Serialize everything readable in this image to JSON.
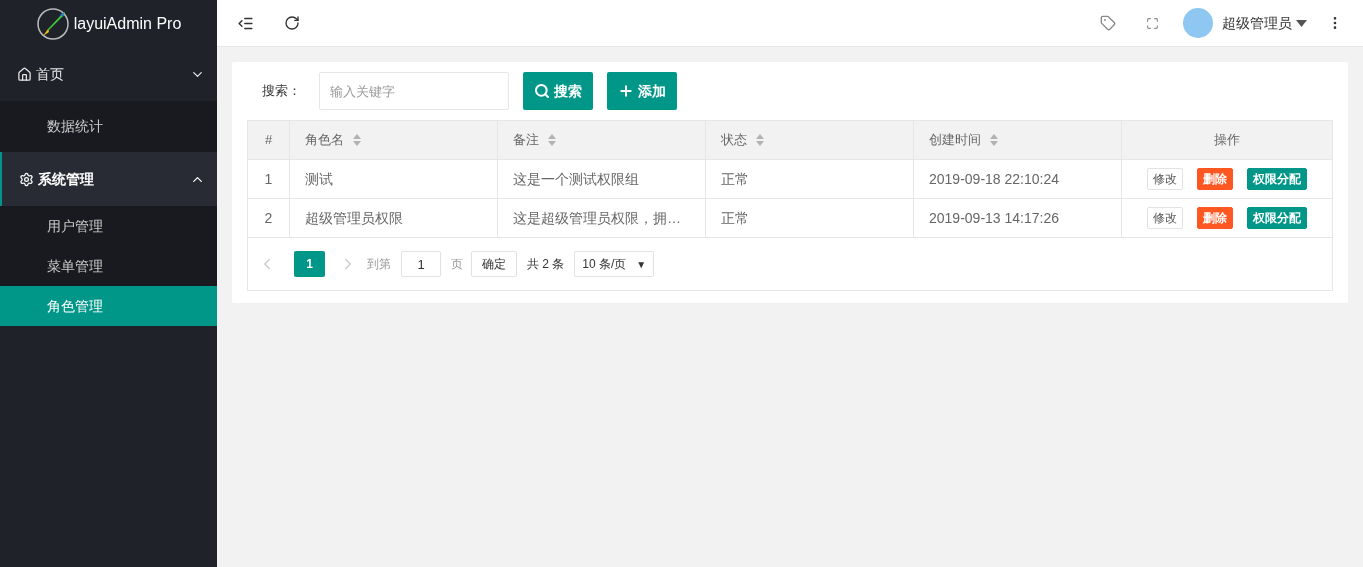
{
  "brand": {
    "title": "layuiAdmin Pro"
  },
  "sidebar": {
    "items": [
      {
        "label": "首页",
        "kind": "home",
        "expanded": false,
        "active": false,
        "children": [
          {
            "label": "数据统计",
            "selected": false
          }
        ]
      },
      {
        "label": "系统管理",
        "kind": "settings",
        "expanded": true,
        "active": true,
        "children": [
          {
            "label": "用户管理",
            "selected": false
          },
          {
            "label": "菜单管理",
            "selected": false
          },
          {
            "label": "角色管理",
            "selected": true
          }
        ]
      }
    ]
  },
  "header": {
    "user": "超级管理员"
  },
  "search": {
    "label": "搜索：",
    "placeholder": "输入关键字",
    "buttons": [
      {
        "kind": "search",
        "label": "搜索"
      },
      {
        "kind": "add",
        "label": "添加"
      }
    ]
  },
  "table": {
    "columns": [
      {
        "label": "#",
        "sortable": false
      },
      {
        "label": "角色名",
        "sortable": true
      },
      {
        "label": "备注",
        "sortable": true
      },
      {
        "label": "状态",
        "sortable": true
      },
      {
        "label": "创建时间",
        "sortable": true
      },
      {
        "label": "操作",
        "sortable": false
      }
    ],
    "rows": [
      {
        "cells": [
          "1",
          "测试",
          "这是一个测试权限组",
          "正常",
          "2019-09-18 22:10:24"
        ],
        "actions": [
          {
            "kind": "plain",
            "label": "修改"
          },
          {
            "kind": "danger",
            "label": "删除"
          },
          {
            "kind": "primary",
            "label": "权限分配"
          }
        ]
      },
      {
        "cells": [
          "2",
          "超级管理员权限",
          "这是超级管理员权限，拥…",
          "正常",
          "2019-09-13 14:17:26"
        ],
        "actions": [
          {
            "kind": "plain",
            "label": "修改"
          },
          {
            "kind": "danger",
            "label": "删除"
          },
          {
            "kind": "primary",
            "label": "权限分配"
          }
        ]
      }
    ]
  },
  "pagination": {
    "pages": [
      {
        "label": "1",
        "selected": true
      }
    ],
    "goto_label": "到第",
    "goto_value": "1",
    "page_unit": "页",
    "confirm": "确定",
    "total": "共 2 条",
    "page_size": "10 条/页",
    "page_size_caret": "▼"
  }
}
